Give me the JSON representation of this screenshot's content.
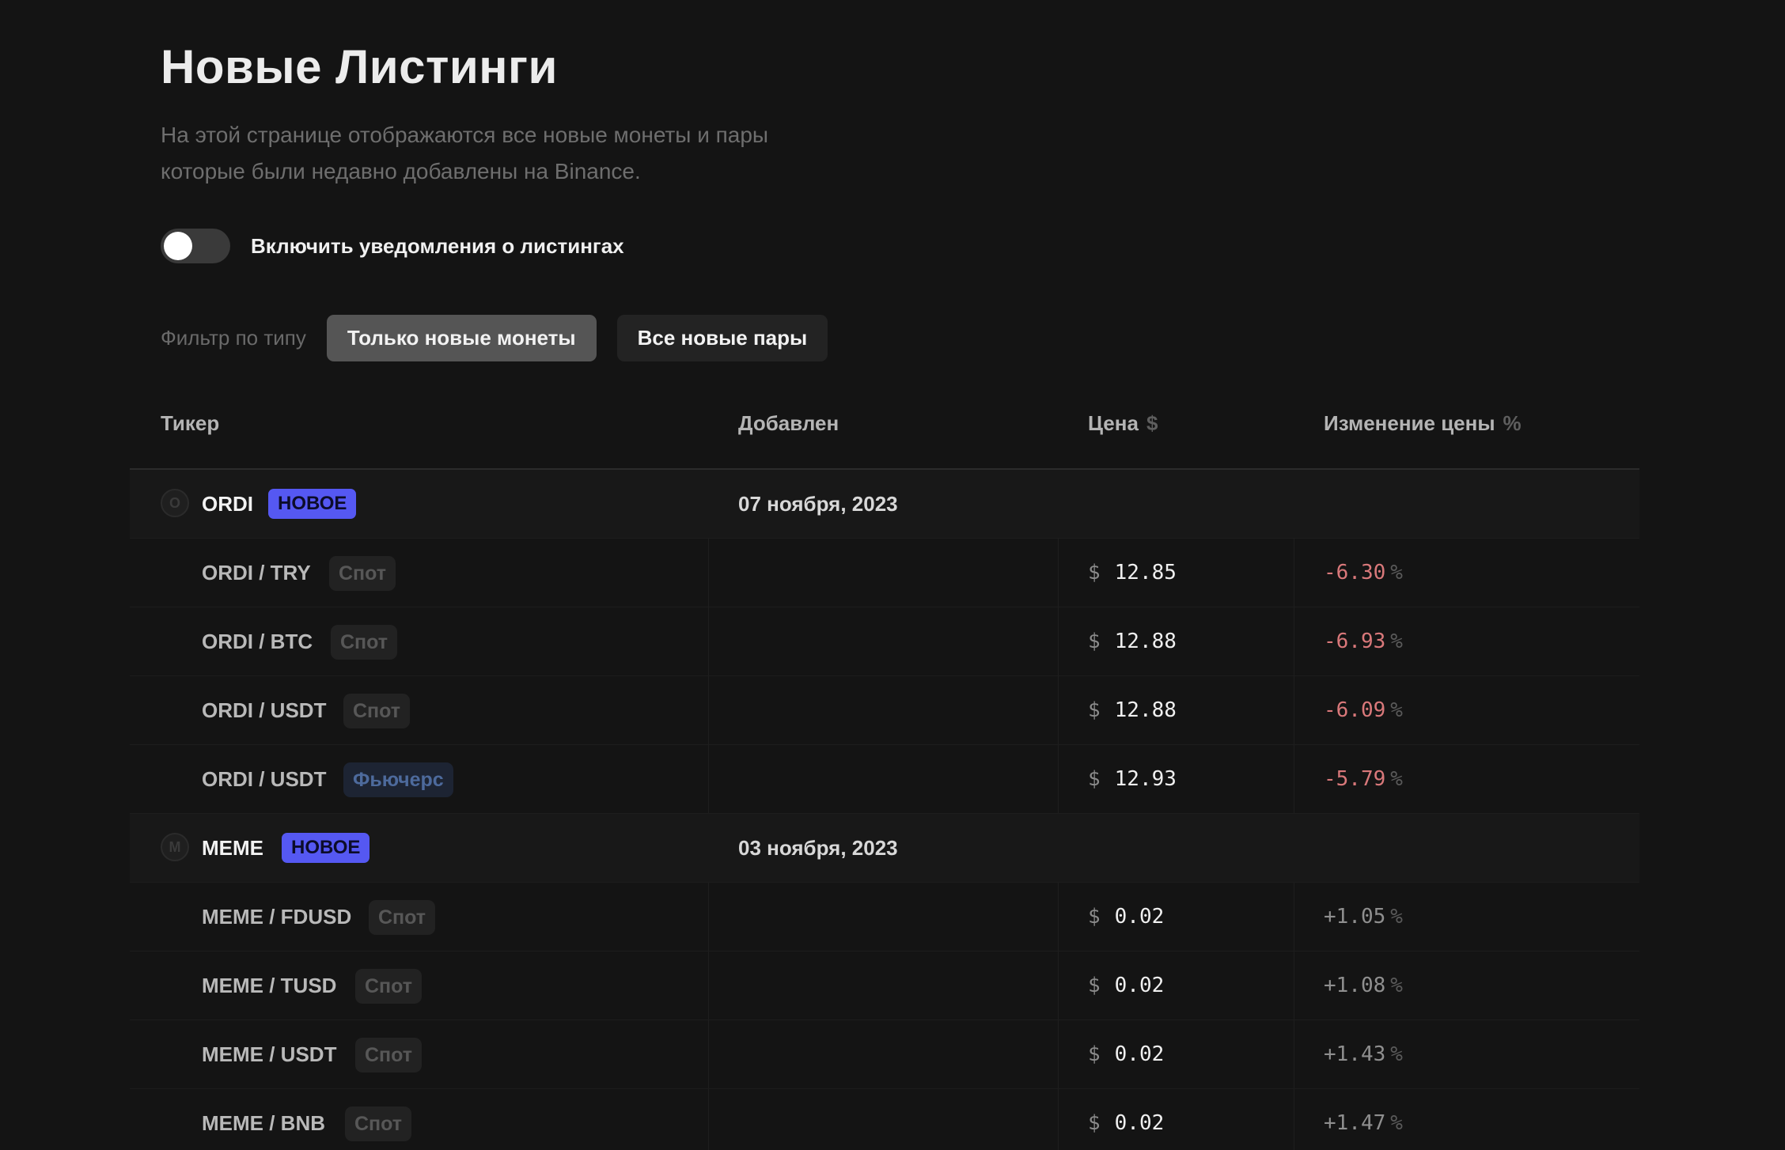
{
  "header": {
    "title": "Новые Листинги",
    "subtitle_line1": "На этой странице отображаются все новые монеты и пары",
    "subtitle_line2": "которые были недавно добавлены на Binance."
  },
  "notifications": {
    "label": "Включить уведомления о листингах",
    "enabled": false
  },
  "filter": {
    "label": "Фильтр по типу",
    "options": [
      "Только новые монеты",
      "Все новые пары"
    ],
    "selected": "Только новые монеты"
  },
  "table": {
    "columns": {
      "ticker": "Тикер",
      "added": "Добавлен",
      "price": "Цена",
      "price_unit": "$",
      "change": "Изменение цены",
      "change_unit": "%"
    },
    "groups": [
      {
        "icon_letter": "O",
        "coin": "ORDI",
        "badge": "НОВОЕ",
        "date": "07 ноября, 2023",
        "pairs": [
          {
            "pair": "ORDI / TRY",
            "type": "Спот",
            "type_kind": "spot",
            "currency": "$",
            "price": "12.85",
            "change": "-6.30",
            "change_unit": "%"
          },
          {
            "pair": "ORDI / BTC",
            "type": "Спот",
            "type_kind": "spot",
            "currency": "$",
            "price": "12.88",
            "change": "-6.93",
            "change_unit": "%"
          },
          {
            "pair": "ORDI / USDT",
            "type": "Спот",
            "type_kind": "spot",
            "currency": "$",
            "price": "12.88",
            "change": "-6.09",
            "change_unit": "%"
          },
          {
            "pair": "ORDI / USDT",
            "type": "Фьючерс",
            "type_kind": "futures",
            "currency": "$",
            "price": "12.93",
            "change": "-5.79",
            "change_unit": "%"
          }
        ]
      },
      {
        "icon_letter": "M",
        "coin": "MEME",
        "badge": "НОВОЕ",
        "date": "03 ноября, 2023",
        "pairs": [
          {
            "pair": "MEME / FDUSD",
            "type": "Спот",
            "type_kind": "spot",
            "currency": "$",
            "price": "0.02",
            "change": "+1.05",
            "change_unit": "%"
          },
          {
            "pair": "MEME / TUSD",
            "type": "Спот",
            "type_kind": "spot",
            "currency": "$",
            "price": "0.02",
            "change": "+1.08",
            "change_unit": "%"
          },
          {
            "pair": "MEME / USDT",
            "type": "Спот",
            "type_kind": "spot",
            "currency": "$",
            "price": "0.02",
            "change": "+1.43",
            "change_unit": "%"
          },
          {
            "pair": "MEME / BNB",
            "type": "Спот",
            "type_kind": "spot",
            "currency": "$",
            "price": "0.02",
            "change": "+1.47",
            "change_unit": "%"
          }
        ]
      }
    ]
  },
  "colors": {
    "background": "#141414",
    "new_badge": "#5558f2",
    "negative_change": "#d9787a",
    "positive_change": "#8f8f8f",
    "futures_badge_text": "#4d6a9c"
  }
}
